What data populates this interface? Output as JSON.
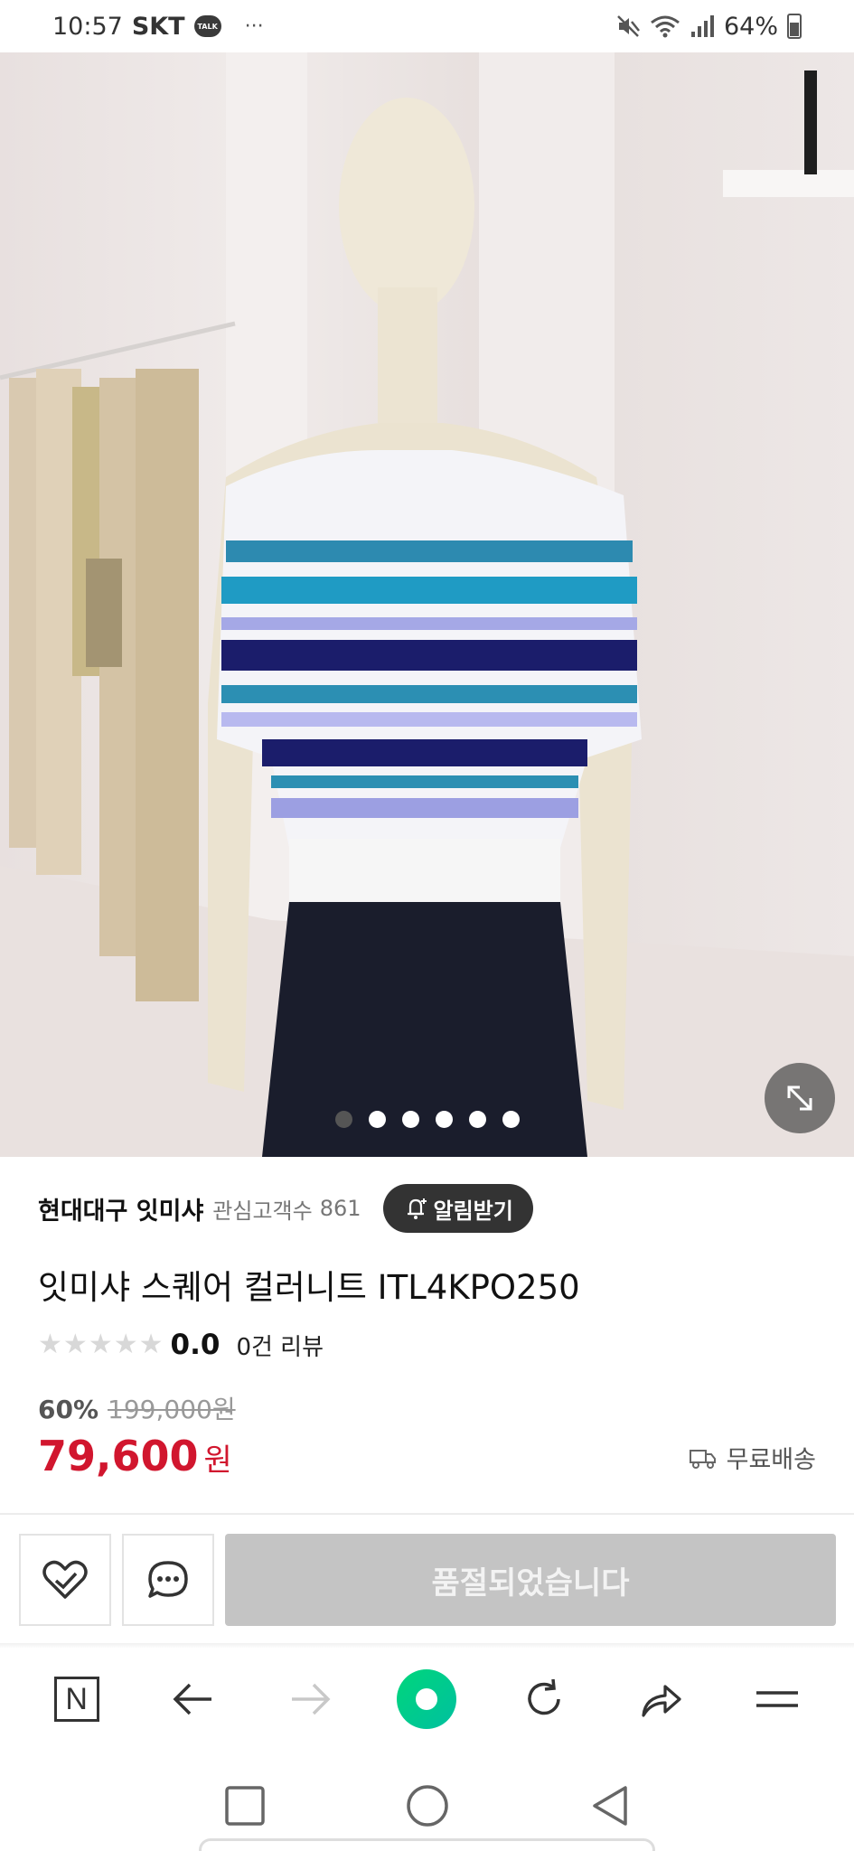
{
  "status_bar": {
    "time": "10:57",
    "carrier": "SKT",
    "talk_badge": "TALK",
    "more": "···",
    "battery": "64%",
    "battery_level": 0.64
  },
  "gallery": {
    "image_count": 6,
    "active_index": 0
  },
  "product": {
    "store_name": "현대대구 잇미샤",
    "follower_label": "관심고객수",
    "follower_count": "861",
    "alarm_button": "알림받기",
    "title": "잇미샤 스퀘어 컬러니트 ITL4KPO250",
    "rating_score": "0.0",
    "rating_value": 0,
    "review_count": "0건 리뷰",
    "discount_rate": "60%",
    "original_price": "199,000원",
    "sale_price": "79,600",
    "currency": "원",
    "delivery": "무료배송"
  },
  "actions": {
    "soldout_label": "품절되었습니다"
  },
  "colors": {
    "price_red": "#d1162e",
    "naver_green": "#00d67b",
    "soldout_gray": "#c4c4c4"
  },
  "icons": {
    "toolbar": [
      "naver-n-icon",
      "back-arrow-icon",
      "forward-arrow-icon",
      "green-dot-icon",
      "refresh-icon",
      "share-icon",
      "menu-icon"
    ],
    "system_nav": [
      "recents-icon",
      "home-icon",
      "back-icon"
    ]
  }
}
